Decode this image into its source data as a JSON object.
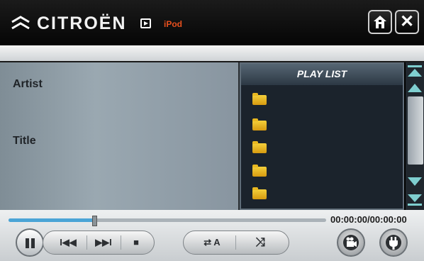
{
  "header": {
    "brand": "CITROËN",
    "source_icon": "play-square-icon",
    "source_label": "iPod",
    "home_icon": "home-icon",
    "close_icon": "close-icon",
    "close_glyph": "✕"
  },
  "info": {
    "artist_label": "Artist",
    "title_label": "Title"
  },
  "playlist": {
    "title": "PLAY LIST",
    "items": [
      "folder-icon",
      "folder-icon",
      "folder-icon",
      "folder-icon",
      "folder-icon"
    ]
  },
  "scroll": {
    "buttons": [
      "scroll-top-icon",
      "scroll-up-icon",
      "scroll-down-icon",
      "scroll-bottom-icon"
    ]
  },
  "playback": {
    "time": "00:00:00/00:00:00",
    "progress_fraction": 0.27
  },
  "controls": {
    "pause_icon": "pause-icon",
    "prev": "I◀◀",
    "next": "▶▶I",
    "stop": "■",
    "repeat": "⇄ A",
    "shuffle": "⤨"
  },
  "colors": {
    "accent_orange": "#e8501e",
    "progress_blue": "#4aa4d6",
    "folder_yellow": "#f0c02a",
    "arrow_teal": "#7fcfd0"
  }
}
